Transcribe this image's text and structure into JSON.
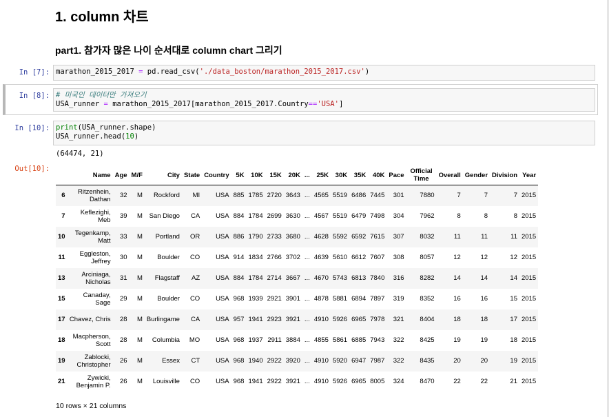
{
  "heading1": "1. column 차트",
  "heading2": "part1. 참가자 많은 나이 순서대로 column chart 그리기",
  "cells": [
    {
      "prompt": "In [7]:",
      "code": [
        [
          {
            "t": "t",
            "v": "marathon_2015_2017 "
          },
          {
            "t": "op",
            "v": "="
          },
          {
            "t": "t",
            "v": " pd.read_csv("
          },
          {
            "t": "str",
            "v": "'./data_boston/marathon_2015_2017.csv'"
          },
          {
            "t": "t",
            "v": ")"
          }
        ]
      ]
    },
    {
      "prompt": "In [8]:",
      "code": [
        [
          {
            "t": "cmt",
            "v": "# 미국인 데이터만 가져오기"
          }
        ],
        [
          {
            "t": "t",
            "v": "USA_runner "
          },
          {
            "t": "op",
            "v": "="
          },
          {
            "t": "t",
            "v": " marathon_2015_2017[marathon_2015_2017.Country"
          },
          {
            "t": "op",
            "v": "=="
          },
          {
            "t": "str",
            "v": "'USA'"
          },
          {
            "t": "t",
            "v": "]"
          }
        ]
      ]
    },
    {
      "prompt": "In [10]:",
      "code": [
        [
          {
            "t": "kw",
            "v": "print"
          },
          {
            "t": "t",
            "v": "(USA_runner.shape)"
          }
        ],
        [
          {
            "t": "t",
            "v": "USA_runner.head("
          },
          {
            "t": "num",
            "v": "10"
          },
          {
            "t": "t",
            "v": ")"
          }
        ]
      ]
    }
  ],
  "stdout": "(64474, 21)",
  "out_prompt": "Out[10]:",
  "table": {
    "columns": [
      "",
      "Name",
      "Age",
      "M/F",
      "City",
      "State",
      "Country",
      "5K",
      "10K",
      "15K",
      "20K",
      "...",
      "25K",
      "30K",
      "35K",
      "40K",
      "Pace",
      "Official Time",
      "Overall",
      "Gender",
      "Division",
      "Year"
    ],
    "rows": [
      [
        "6",
        "Ritzenhein, Dathan",
        "32",
        "M",
        "Rockford",
        "MI",
        "USA",
        "885",
        "1785",
        "2720",
        "3643",
        "...",
        "4565",
        "5519",
        "6486",
        "7445",
        "301",
        "7880",
        "7",
        "7",
        "7",
        "2015"
      ],
      [
        "7",
        "Keflezighi, Meb",
        "39",
        "M",
        "San Diego",
        "CA",
        "USA",
        "884",
        "1784",
        "2699",
        "3630",
        "...",
        "4567",
        "5519",
        "6479",
        "7498",
        "304",
        "7962",
        "8",
        "8",
        "8",
        "2015"
      ],
      [
        "10",
        "Tegenkamp, Matt",
        "33",
        "M",
        "Portland",
        "OR",
        "USA",
        "886",
        "1790",
        "2733",
        "3680",
        "...",
        "4628",
        "5592",
        "6592",
        "7615",
        "307",
        "8032",
        "11",
        "11",
        "11",
        "2015"
      ],
      [
        "11",
        "Eggleston, Jeffrey",
        "30",
        "M",
        "Boulder",
        "CO",
        "USA",
        "914",
        "1834",
        "2766",
        "3702",
        "...",
        "4639",
        "5610",
        "6612",
        "7607",
        "308",
        "8057",
        "12",
        "12",
        "12",
        "2015"
      ],
      [
        "13",
        "Arciniaga, Nicholas",
        "31",
        "M",
        "Flagstaff",
        "AZ",
        "USA",
        "884",
        "1784",
        "2714",
        "3667",
        "...",
        "4670",
        "5743",
        "6813",
        "7840",
        "316",
        "8282",
        "14",
        "14",
        "14",
        "2015"
      ],
      [
        "15",
        "Canaday, Sage",
        "29",
        "M",
        "Boulder",
        "CO",
        "USA",
        "968",
        "1939",
        "2921",
        "3901",
        "...",
        "4878",
        "5881",
        "6894",
        "7897",
        "319",
        "8352",
        "16",
        "16",
        "15",
        "2015"
      ],
      [
        "17",
        "Chavez, Chris",
        "28",
        "M",
        "Burlingame",
        "CA",
        "USA",
        "957",
        "1941",
        "2923",
        "3921",
        "...",
        "4910",
        "5926",
        "6965",
        "7978",
        "321",
        "8404",
        "18",
        "18",
        "17",
        "2015"
      ],
      [
        "18",
        "Macpherson, Scott",
        "28",
        "M",
        "Columbia",
        "MO",
        "USA",
        "968",
        "1937",
        "2911",
        "3884",
        "...",
        "4855",
        "5861",
        "6885",
        "7943",
        "322",
        "8425",
        "19",
        "19",
        "18",
        "2015"
      ],
      [
        "19",
        "Zablocki, Christopher",
        "26",
        "M",
        "Essex",
        "CT",
        "USA",
        "968",
        "1940",
        "2922",
        "3920",
        "...",
        "4910",
        "5920",
        "6947",
        "7987",
        "322",
        "8435",
        "20",
        "20",
        "19",
        "2015"
      ],
      [
        "21",
        "Zywicki, Benjamin P.",
        "26",
        "M",
        "Louisville",
        "CO",
        "USA",
        "968",
        "1941",
        "2922",
        "3921",
        "...",
        "4910",
        "5926",
        "6965",
        "8005",
        "324",
        "8470",
        "22",
        "22",
        "21",
        "2015"
      ]
    ]
  },
  "footer": "10 rows × 21 columns"
}
